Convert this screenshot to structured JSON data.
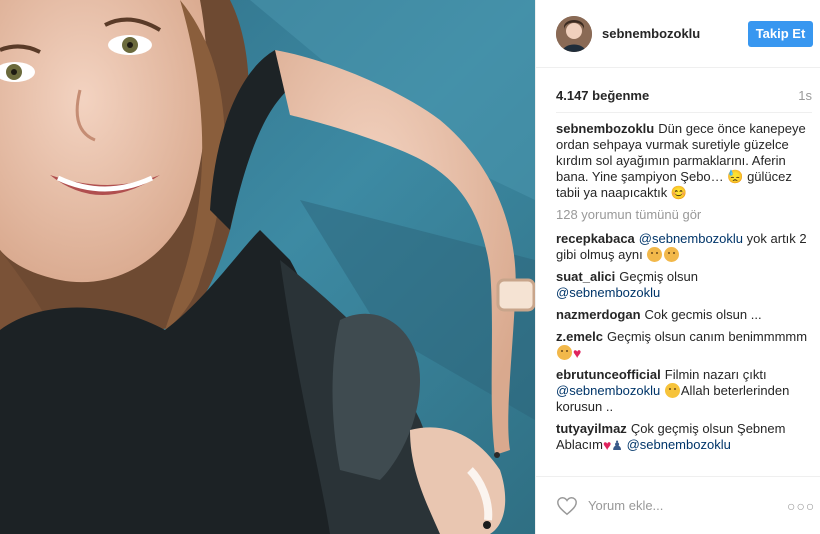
{
  "post": {
    "username": "sebnembozoklu",
    "follow_label": "Takip Et",
    "likes": "4.147 beğenme",
    "time": "1s",
    "caption": {
      "user": "sebnembozoklu",
      "text": "Dün gece önce kanepeye ordan sehpaya vurmak suretiyle güzelce kırdım sol ayağımın parmaklarını. Aferin bana. Yine şampiyon Şebo… 😓 gülücez tabii ya naapıcaktık 😊"
    },
    "more_comments": "128 yorumun tümünü gör",
    "comments": [
      {
        "user": "recepkabaca",
        "mention": "@sebnembozoklu",
        "text": "yok artık 2 gibi olmuş aynı"
      },
      {
        "user": "suat_alici",
        "text": "Geçmiş olsun",
        "mention": "@sebnembozoklu"
      },
      {
        "user": "nazmerdogan",
        "text": "Cok gecmis olsun ..."
      },
      {
        "user": "z.emelc",
        "text": "Geçmiş olsun canım benimmmmm"
      },
      {
        "user": "ebrutunceofficial",
        "text": "Filmin nazarı çıktı",
        "mention": "@sebnembozoklu",
        "text2": "Allah beterlerinden korusun .."
      },
      {
        "user": "tutyayilmaz",
        "text": "Çok geçmiş olsun Şebnem Ablacım",
        "mention": "@sebnembozoklu"
      }
    ],
    "comment_placeholder": "Yorum ekle...",
    "more_options": "○○○"
  },
  "colors": {
    "follow_button": "#3897f0",
    "mention": "#003569",
    "muted": "#999999"
  }
}
